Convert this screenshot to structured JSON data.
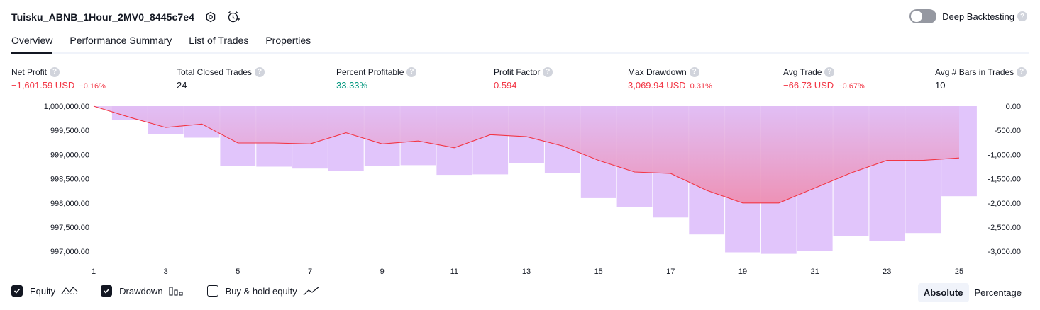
{
  "header": {
    "title": "Tuisku_ABNB_1Hour_2MV0_8445c7e4",
    "deep_backtesting_label": "Deep Backtesting",
    "help_glyph": "?"
  },
  "tabs": [
    {
      "label": "Overview"
    },
    {
      "label": "Performance Summary"
    },
    {
      "label": "List of Trades"
    },
    {
      "label": "Properties"
    }
  ],
  "metrics": [
    {
      "label": "Net Profit",
      "value": "−1,601.59 USD",
      "pct": "−0.16%",
      "tone": "neg"
    },
    {
      "label": "Total Closed Trades",
      "value": "24",
      "pct": "",
      "tone": "neutral"
    },
    {
      "label": "Percent Profitable",
      "value": "33.33%",
      "pct": "",
      "tone": "pos"
    },
    {
      "label": "Profit Factor",
      "value": "0.594",
      "pct": "",
      "tone": "neg"
    },
    {
      "label": "Max Drawdown",
      "value": "3,069.94 USD",
      "pct": "0.31%",
      "tone": "neg"
    },
    {
      "label": "Avg Trade",
      "value": "−66.73 USD",
      "pct": "−0.67%",
      "tone": "neg"
    },
    {
      "label": "Avg # Bars in Trades",
      "value": "10",
      "pct": "",
      "tone": "neutral"
    }
  ],
  "colors": {
    "neg": "#f23645",
    "pos": "#089981",
    "drawdown_bar": "#e1c5fb",
    "equity_line": "#f23645"
  },
  "chart_data": {
    "type": "line",
    "x": [
      1,
      2,
      3,
      4,
      5,
      6,
      7,
      8,
      9,
      10,
      11,
      12,
      13,
      14,
      15,
      16,
      17,
      18,
      19,
      20,
      21,
      22,
      23,
      24,
      25
    ],
    "xticks": [
      "1",
      "3",
      "5",
      "7",
      "9",
      "11",
      "13",
      "15",
      "17",
      "19",
      "21",
      "23",
      "25"
    ],
    "series": [
      {
        "key": "equity",
        "values": [
          1000000,
          999770,
          999560,
          999630,
          999240,
          999240,
          999220,
          999450,
          999220,
          999280,
          999140,
          999410,
          999370,
          999180,
          998880,
          998640,
          998610,
          998260,
          998000,
          998000,
          998310,
          998620,
          998880,
          998880,
          998930
        ]
      },
      {
        "key": "drawdown",
        "type": "bar",
        "values": [
          0,
          -290,
          -580,
          -650,
          -1230,
          -1250,
          -1290,
          -1330,
          -1230,
          -1220,
          -1420,
          -1410,
          -1170,
          -1380,
          -1900,
          -2080,
          -2300,
          -2650,
          -3020,
          -3050,
          -2990,
          -2680,
          -2790,
          -2620,
          -1860
        ]
      }
    ],
    "y_left_ticks": [
      "1,000,000.00",
      "999,500.00",
      "999,000.00",
      "998,500.00",
      "998,000.00",
      "997,500.00",
      "997,000.00"
    ],
    "y_right_ticks": [
      "0.00",
      "-500.00",
      "-1,000.00",
      "-1,500.00",
      "-2,000.00",
      "-2,500.00",
      "-3,000.00"
    ],
    "ylim_left": [
      996900,
      1000000
    ],
    "ylim_right": [
      -3100,
      0
    ],
    "grid": false
  },
  "legend": [
    {
      "label": "Equity",
      "checked": true,
      "icon": "equity-line-icon"
    },
    {
      "label": "Drawdown",
      "checked": true,
      "icon": "bar-chart-icon"
    },
    {
      "label": "Buy & hold equity",
      "checked": false,
      "icon": "trend-line-icon"
    }
  ],
  "modes": [
    {
      "label": "Absolute",
      "active": true
    },
    {
      "label": "Percentage",
      "active": false
    }
  ]
}
